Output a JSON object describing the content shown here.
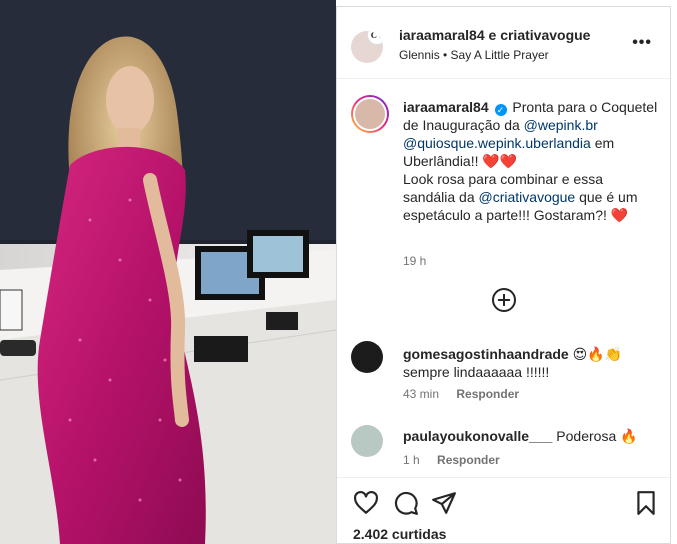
{
  "post_header": {
    "title": "iaraamaral84 e criativavogue",
    "audio": "Glennis • Say A Little Prayer",
    "avatar_badge": "CV",
    "more_icon": "ellipsis-icon"
  },
  "caption": {
    "username": "iaraamaral84",
    "verified_icon": "verified-badge-icon",
    "text_1": "Pronta para o Coquetel de Inauguração da",
    "mention_1": "@wepink.br",
    "mention_2": "@quiosque.wepink.uberlandia",
    "text_2": "em Uberlândia!!",
    "text_3": "Look rosa para combinar e essa sandália da",
    "mention_3": "@criativavogue",
    "text_4": "que é um espetáculo a parte!!! Gostaram?!",
    "emoji_hearts_double": "❤️❤️",
    "emoji_heart_single": "❤️",
    "time": "19 h"
  },
  "add_comments_icon": "plus-circle-icon",
  "comments": [
    {
      "username": "gomesagostinhaandrade",
      "emojis": "😍🔥👏",
      "text": "sempre lindaaaaaa !!!!!!",
      "time": "43 min",
      "reply_label": "Responder"
    },
    {
      "username": "paulayoukonovalle___",
      "text": "Poderosa",
      "emojis": "🔥",
      "time": "1 h",
      "reply_label": "Responder"
    }
  ],
  "actions": {
    "like_icon": "heart-icon",
    "comment_icon": "comment-icon",
    "share_icon": "share-icon",
    "save_icon": "bookmark-icon",
    "likes": "2.402 curtidas"
  },
  "colors": {
    "link": "#00376b",
    "verified": "#0095f6",
    "dress": "#c2156e",
    "muted": "#737373"
  }
}
